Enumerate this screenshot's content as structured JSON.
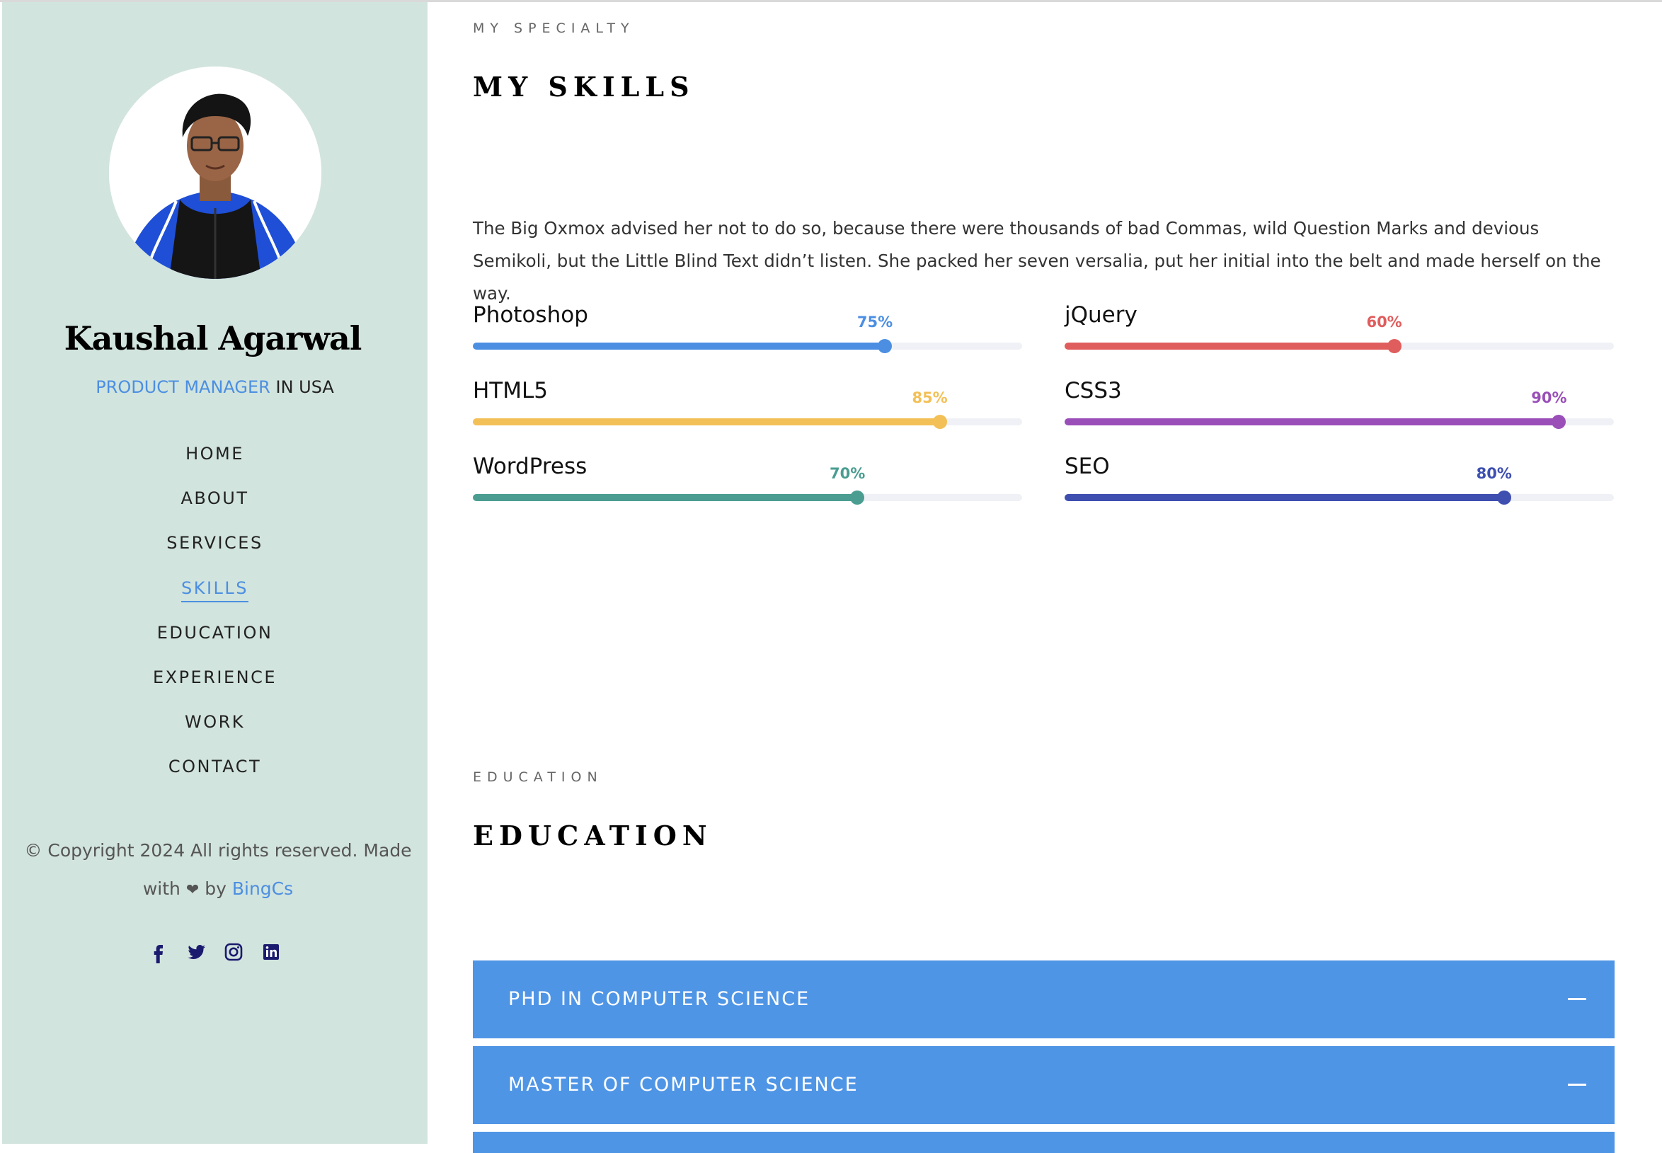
{
  "profile": {
    "name": "Kaushal Agarwal",
    "role_accent": "PRODUCT MANAGER",
    "role_rest": "IN USA"
  },
  "nav": {
    "items": [
      {
        "label": "HOME"
      },
      {
        "label": "ABOUT"
      },
      {
        "label": "SERVICES"
      },
      {
        "label": "SKILLS"
      },
      {
        "label": "EDUCATION"
      },
      {
        "label": "EXPERIENCE"
      },
      {
        "label": "WORK"
      },
      {
        "label": "CONTACT"
      }
    ],
    "active": "SKILLS"
  },
  "footer": {
    "copyright_prefix": "© Copyright 2024 All rights reserved. Made",
    "with": "with",
    "heart": "❤",
    "by": "by",
    "link": "BingCs"
  },
  "social": [
    "facebook-icon",
    "twitter-icon",
    "instagram-icon",
    "linkedin-icon"
  ],
  "skills_section": {
    "subheading": "MY SPECIALTY",
    "heading": "MY SKILLS",
    "intro": "The Big Oxmox advised her not to do so, because there were thousands of bad Commas, wild Question Marks and devious Semikoli, but the Little Blind Text didn’t listen. She packed her seven versalia, put her initial into the belt and made herself on the way.",
    "skills": [
      {
        "name": "Photoshop",
        "percent": 75,
        "percent_label": "75%",
        "color": "#4c8fe2"
      },
      {
        "name": "jQuery",
        "percent": 60,
        "percent_label": "60%",
        "color": "#e05d5d"
      },
      {
        "name": "HTML5",
        "percent": 85,
        "percent_label": "85%",
        "color": "#f3c057"
      },
      {
        "name": "CSS3",
        "percent": 90,
        "percent_label": "90%",
        "color": "#9a4fb8"
      },
      {
        "name": "WordPress",
        "percent": 70,
        "percent_label": "70%",
        "color": "#4a9d90"
      },
      {
        "name": "SEO",
        "percent": 80,
        "percent_label": "80%",
        "color": "#3e4fb0"
      }
    ]
  },
  "education_section": {
    "subheading": "EDUCATION",
    "heading": "EDUCATION",
    "items": [
      {
        "title": "PHD IN COMPUTER SCIENCE"
      },
      {
        "title": "MASTER OF COMPUTER SCIENCE"
      }
    ]
  },
  "colors": {
    "sidebar_bg": "#d2e4de",
    "accent": "#4c8fe2",
    "accordion_bg": "#4f95e6"
  }
}
